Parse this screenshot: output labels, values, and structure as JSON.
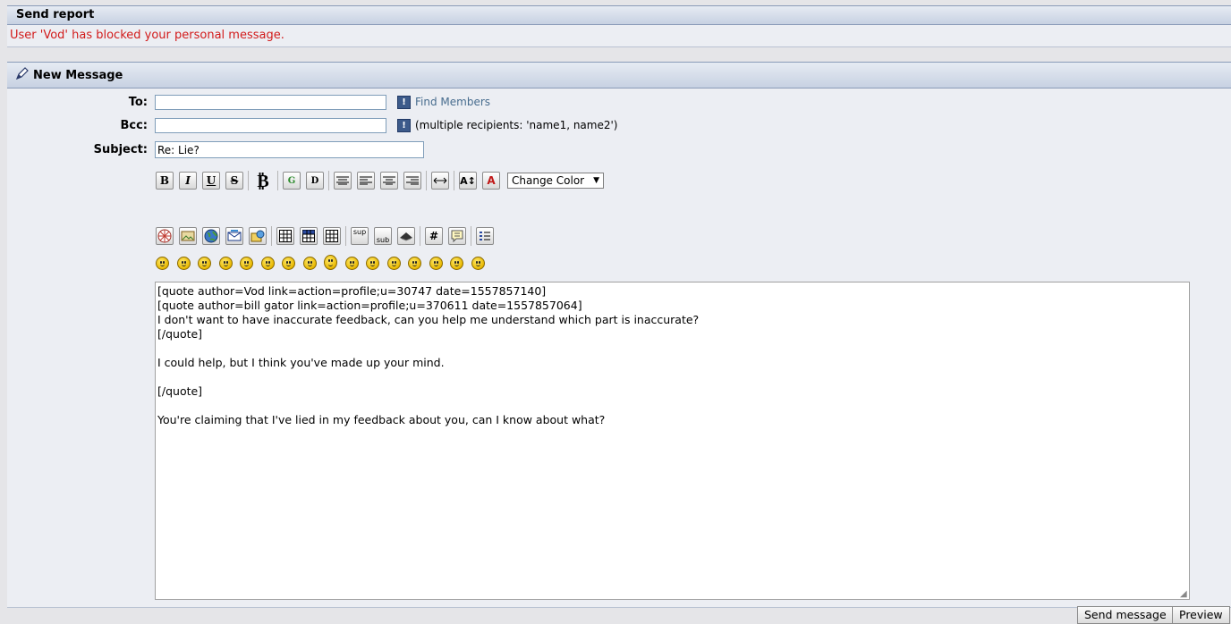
{
  "report": {
    "title": "Send report",
    "message": "User 'Vod' has blocked your personal message."
  },
  "compose": {
    "title": "New Message",
    "to_label": "To:",
    "to_value": "",
    "find_members": "Find Members",
    "bcc_label": "Bcc:",
    "bcc_value": "",
    "bcc_hint": "(multiple recipients: 'name1, name2')",
    "subject_label": "Subject:",
    "subject_value": "Re: Lie?",
    "color_select": "Change Color",
    "body": "[quote author=Vod link=action=profile;u=30747 date=1557857140]\n[quote author=bill gator link=action=profile;u=370611 date=1557857064]\nI don't want to have inaccurate feedback, can you help me understand which part is inaccurate?\n[/quote]\n\nI could help, but I think you've made up your mind.\n\n[/quote]\n\nYou're claiming that I've lied in my feedback about you, can I know about what?",
    "send_label": "Send message",
    "preview_label": "Preview"
  },
  "toolbar": {
    "row1": [
      "B",
      "I",
      "U",
      "S",
      "₿",
      "G",
      "D"
    ],
    "sup": "sup",
    "sub": "sub",
    "hash": "#"
  }
}
